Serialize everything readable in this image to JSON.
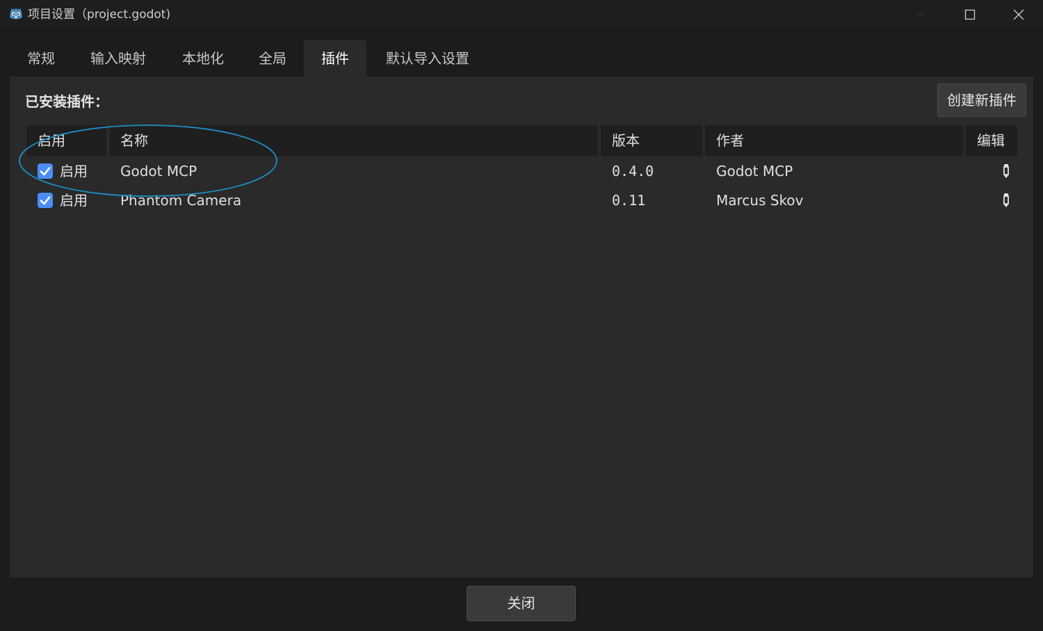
{
  "window": {
    "title": "项目设置（project.godot)",
    "app_icon": "godot-icon",
    "controls": [
      "minimize-icon",
      "maximize-icon",
      "close-icon"
    ]
  },
  "tabs": [
    {
      "label": "常规",
      "active": false
    },
    {
      "label": "输入映射",
      "active": false
    },
    {
      "label": "本地化",
      "active": false
    },
    {
      "label": "全局",
      "active": false
    },
    {
      "label": "插件",
      "active": true
    },
    {
      "label": "默认导入设置",
      "active": false
    }
  ],
  "plugins": {
    "installed_label": "已安装插件：",
    "create_button": "创建新插件",
    "columns": {
      "enable": "启用",
      "name": "名称",
      "version": "版本",
      "author": "作者",
      "edit": "编辑"
    },
    "rows": [
      {
        "enabled": true,
        "enable_label": "启用",
        "name": "Godot MCP",
        "version": "0.4.0",
        "author": "Godot MCP",
        "edit_icon": "pencil-icon"
      },
      {
        "enabled": true,
        "enable_label": "启用",
        "name": "Phantom Camera",
        "version": "0.11",
        "author": "Marcus Skov",
        "edit_icon": "pencil-icon"
      }
    ]
  },
  "footer": {
    "close_button": "关闭"
  },
  "colors": {
    "accent": "#4a8ef7",
    "annotation": "#1e8fc6",
    "panel": "#2a2a2a",
    "background": "#1c1c1c"
  }
}
